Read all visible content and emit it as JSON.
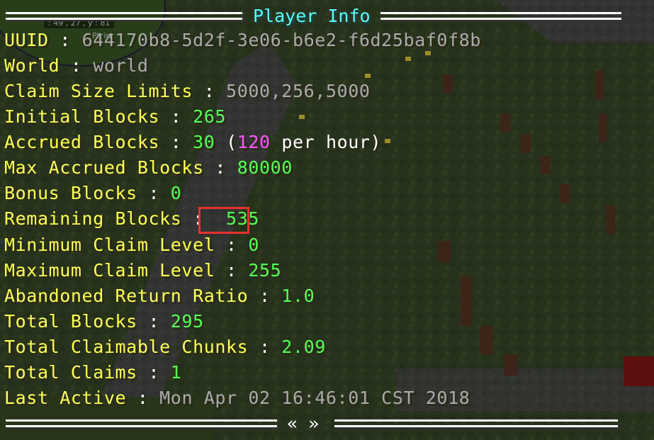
{
  "header": {
    "title": "Player Info"
  },
  "minimap": {
    "coords": ": 49 , 27 , y : 81",
    "biome": "Plains"
  },
  "fields": {
    "uuid": {
      "label": "UUID",
      "value": "644170b8-5d2f-3e06-b6e2-f6d25baf0f8b"
    },
    "world": {
      "label": "World",
      "value": "world"
    },
    "claim_size": {
      "label": "Claim Size Limits",
      "value": "5000,256,5000"
    },
    "initial": {
      "label": "Initial Blocks",
      "value": "265"
    },
    "accrued": {
      "label": "Accrued Blocks",
      "value": "30",
      "rate_open": "(",
      "rate": "120",
      "rate_suffix": "per hour)"
    },
    "max_accrued": {
      "label": "Max Accrued Blocks",
      "value": "80000"
    },
    "bonus": {
      "label": "Bonus Blocks",
      "value": "0"
    },
    "remaining": {
      "label": "Remaining Blocks",
      "value": "535"
    },
    "min_level": {
      "label": "Minimum Claim Level",
      "value": "0"
    },
    "max_level": {
      "label": "Maximum Claim Level",
      "value": "255"
    },
    "abandoned": {
      "label": "Abandoned Return Ratio",
      "value": "1.0"
    },
    "total_blocks": {
      "label": "Total Blocks",
      "value": "295"
    },
    "chunks": {
      "label": "Total Claimable Chunks",
      "value": "2.09"
    },
    "claims": {
      "label": "Total Claims",
      "value": "1"
    },
    "last_active": {
      "label": "Last Active",
      "value": "Mon Apr 02 16:46:01 CST 2018"
    }
  },
  "separator": ":",
  "footer": {
    "prev": "«",
    "next": "»"
  },
  "colors": {
    "label": "#ffff55",
    "value_green": "#55ff55",
    "value_gray": "#aaaaaa",
    "rate_magenta": "#ff55ff",
    "title_aqua": "#55ffff",
    "highlight": "#e8312f"
  }
}
